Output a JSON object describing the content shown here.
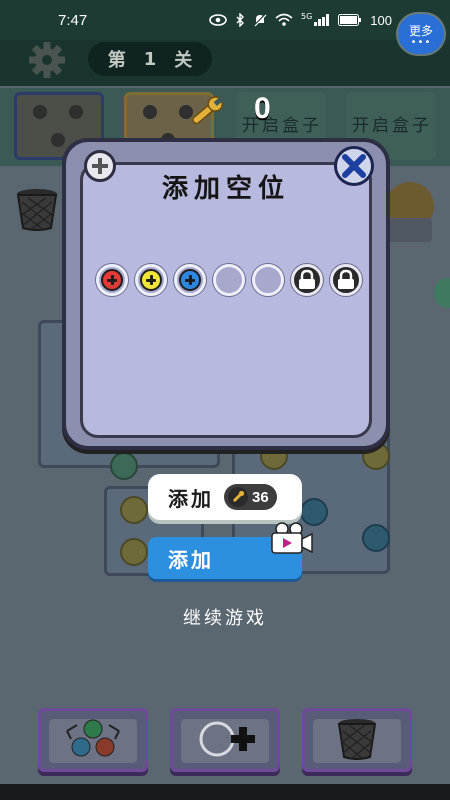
{
  "status_bar": {
    "time": "7:47",
    "battery": "100",
    "network": "5G"
  },
  "top_bar": {
    "level_prefix": "第",
    "level_number": "1",
    "level_suffix": "关",
    "more_label": "更多",
    "more_dots": "•••"
  },
  "boxes": {
    "left_box_text": "开启盒子",
    "right_box_text": "开启盒子",
    "removed_counter": "0"
  },
  "popup": {
    "title": "添加空位",
    "slots": [
      {
        "type": "screw",
        "color": "#e53935",
        "icon": "screw-red-icon"
      },
      {
        "type": "screw",
        "color": "#f2e53a",
        "icon": "screw-yellow-icon"
      },
      {
        "type": "screw",
        "color": "#2f86df",
        "icon": "screw-blue-icon"
      },
      {
        "type": "empty"
      },
      {
        "type": "empty"
      },
      {
        "type": "locked",
        "icon": "lock-icon"
      },
      {
        "type": "locked",
        "icon": "lock-icon"
      }
    ]
  },
  "buttons": {
    "add_with_wrench_label": "添加",
    "wrench_cost": "36",
    "add_with_video_label": "添加",
    "continue_label": "继续游戏"
  },
  "colors": {
    "popup_bg": "#8d8fae",
    "popup_inner": "#b8b9df",
    "video_button": "#2d8fe0",
    "more_button": "#2a6fd6",
    "tool_border": "#6f4a99"
  },
  "toolbar": {
    "items": [
      {
        "name": "shuffle-tool",
        "icon": "swap-colors-icon"
      },
      {
        "name": "add-slot-tool",
        "icon": "add-hole-icon"
      },
      {
        "name": "trash-tool",
        "icon": "trash-basket-icon"
      }
    ]
  }
}
